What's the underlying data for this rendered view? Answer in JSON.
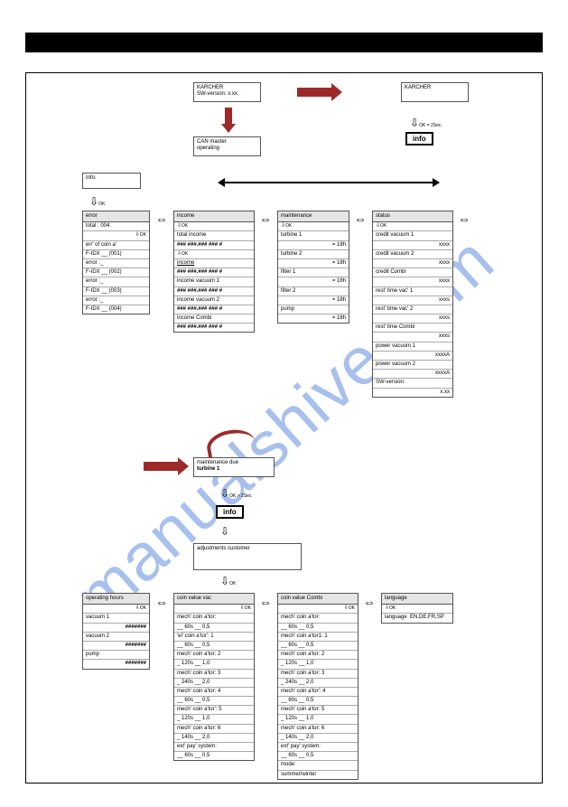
{
  "watermark": "manualshive.com",
  "top": {
    "karcher1_l1": "KARCHER",
    "karcher1_l2": "SW-version: x.xx",
    "karcher2_l1": "KARCHER",
    "canmaster_l1": "CAN master",
    "canmaster_l2": "operating",
    "ok2sec_top": "OK = 2Sec.",
    "info_btn": "info",
    "info_label": "Info:"
  },
  "row1": {
    "error": {
      "title": "error",
      "total": "total : 004",
      "ok": "OK",
      "e1a": "err' of coin a'",
      "e1b": "F-IDX __ (001)",
      "e2a": "error :_",
      "e2b": "F-IDX __ (002)",
      "e3a": "error :_",
      "e3b": "F-IDX __ (003)",
      "e4a": "error :_",
      "e4b": "F-IDX __ (004)"
    },
    "income": {
      "title": "income",
      "ok": "OK",
      "total_income": "total income",
      "total_val": "### ###.### ### #",
      "income_lbl": "income",
      "income_val": "### ###.### ### #",
      "v1": "income vacuum 1",
      "v1_val": "### ###.### ### #",
      "v2": "income vacuum 2",
      "v2_val": "### ###.### ### #",
      "combi": "income Combi",
      "combi_val": "### ###.### ### #"
    },
    "maint": {
      "title": "maintenance",
      "ok": "OK",
      "t1": "turbine 1",
      "t1v": "= 18h",
      "t2": "turbine 2",
      "t2v": "= 18h",
      "f1": "filter 1",
      "f1v": "= 18h",
      "f2": "filter 2",
      "f2v": "= 18h",
      "pump": "pump",
      "pumpv": "= 18h"
    },
    "status": {
      "title": "status",
      "ok": "OK",
      "c1": "credit vacuum 1",
      "c1v": "xxxx",
      "c2": "credit vacuum 2",
      "c2v": "xxxx",
      "cc": "credit Combi",
      "ccv": "xxxx",
      "rt1": "rest' time vac' 1",
      "rt1v": "xxxs",
      "rt2": "rest' time vac' 2",
      "rt2v": "xxxs",
      "rtc": "rest' time Combi",
      "rtcv": "xxxs",
      "pv1": "power vacuum 1",
      "pv1v": "xxxxA",
      "pv2": "power vacuum 2",
      "pv2v": "xxxxA",
      "sw": "SW-version:",
      "swv": "x.xx"
    }
  },
  "mid": {
    "maint_due_l1": "maintenance due",
    "maint_due_l2": "turbine 1",
    "ok2sec": "OK > 2Sec.",
    "info_btn": "info",
    "adj_cust": "adjustments customer",
    "ok": "OK"
  },
  "row2": {
    "ophours": {
      "title": "operating hours",
      "ok": "OK",
      "v1": "vacuum 1",
      "v1v": "#######",
      "v2": "vacuum 2",
      "v2v": "#######",
      "p": "pump",
      "pv": "#######"
    },
    "coinvac": {
      "title": "coin value vac",
      "ok": "OK",
      "m1": "mech' coin a'tor:",
      "m1v": "__ 60s __ 0,5",
      "e1": "'el' coin a'tor': 1",
      "e1v": "__ 60s __ 0,5",
      "m2": "mech' coin a'tor: 2",
      "m2v": "_ 120s __ 1,0",
      "m3": "mech' coin a'tor: 3",
      "m3v": "_ 240s __ 2,0",
      "m4": "mech' coin a'tor: 4",
      "m4v": "__ 60s __ 0,5",
      "m5": "mech' coin a'tor': 5",
      "m5v": "_ 120s __ 1,0",
      "m6": "mech' coin a'tor: 6",
      "m6v": "_ 140s __ 2,0",
      "ext": "ext' pay' system:",
      "extv": "__ 60s __ 0,5"
    },
    "coincombi": {
      "title": "coin value Combi",
      "ok": "OK",
      "m1": "mech' coin a'tor:",
      "m1v": "__ 60s __ 0,5",
      "e1": "mech' coin a'tor1: 1",
      "e1v": "__ 60s __ 0,5",
      "m2": "mech' coin a'tor: 2",
      "m2v": "_ 120s __ 1,0",
      "m3": "mech' coin a'tor: 3",
      "m3v": "_ 240s __ 2,0",
      "m4": "mech' coin a'tor': 4",
      "m4v": "__ 60s __ 0,5",
      "m5": "mech' coin a'tor: 5",
      "m5v": "_ 120s __ 1,0",
      "m6": "mech' coin a'tor: 6",
      "m6v": "_ 140s __ 2,0",
      "ext": "ext' pay' system:",
      "extv": "__ 60s __ 0,5",
      "mode": "mode:",
      "modev": "summer/winter"
    },
    "lang": {
      "title": "language",
      "ok": "OK",
      "lang": "language",
      "langv": "EN,DE,FR,SP"
    }
  }
}
